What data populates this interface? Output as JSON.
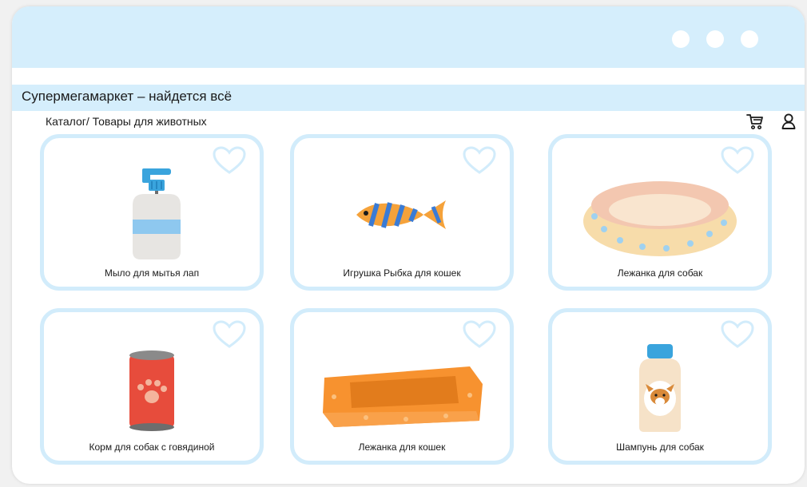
{
  "window": {
    "dots": [
      "dot",
      "dot",
      "dot"
    ]
  },
  "site": {
    "title": "Супермегамаркет – найдется всё"
  },
  "breadcrumb": "Каталог/ Товары для животных",
  "header_icons": [
    "cart-icon",
    "user-icon"
  ],
  "colors": {
    "accent_light_blue": "#d5eefc",
    "card_border": "#d2ecfb",
    "text": "#1b1b1b"
  },
  "products": [
    {
      "name": "Мыло для мытья лап",
      "icon": "soap-dispenser-icon",
      "favorite_icon": "heart-icon"
    },
    {
      "name": "Игрушка Рыбка для кошек",
      "icon": "fish-toy-icon",
      "favorite_icon": "heart-icon"
    },
    {
      "name": "Лежанка для собак",
      "icon": "dog-bed-icon",
      "favorite_icon": "heart-icon"
    },
    {
      "name": "Корм для собак с говядиной",
      "icon": "food-can-icon",
      "favorite_icon": "heart-icon"
    },
    {
      "name": "Лежанка для кошек",
      "icon": "cat-bed-icon",
      "favorite_icon": "heart-icon"
    },
    {
      "name": "Шампунь для собак",
      "icon": "dog-shampoo-icon",
      "favorite_icon": "heart-icon"
    }
  ]
}
